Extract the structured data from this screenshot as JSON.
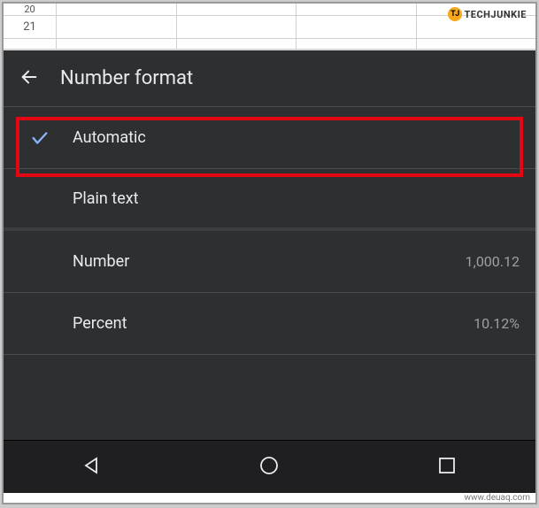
{
  "watermark": {
    "badge": "TJ",
    "text": "TECHJUNKIE"
  },
  "sheet": {
    "rows": [
      {
        "num": "20"
      },
      {
        "num": "21"
      }
    ]
  },
  "panel": {
    "title": "Number format",
    "options": [
      {
        "label": "Automatic",
        "sample": "",
        "selected": true
      },
      {
        "label": "Plain text",
        "sample": "",
        "selected": false
      },
      {
        "label": "Number",
        "sample": "1,000.12",
        "selected": false
      },
      {
        "label": "Percent",
        "sample": "10.12%",
        "selected": false
      }
    ]
  },
  "footer_url": "www.deuaq.com"
}
